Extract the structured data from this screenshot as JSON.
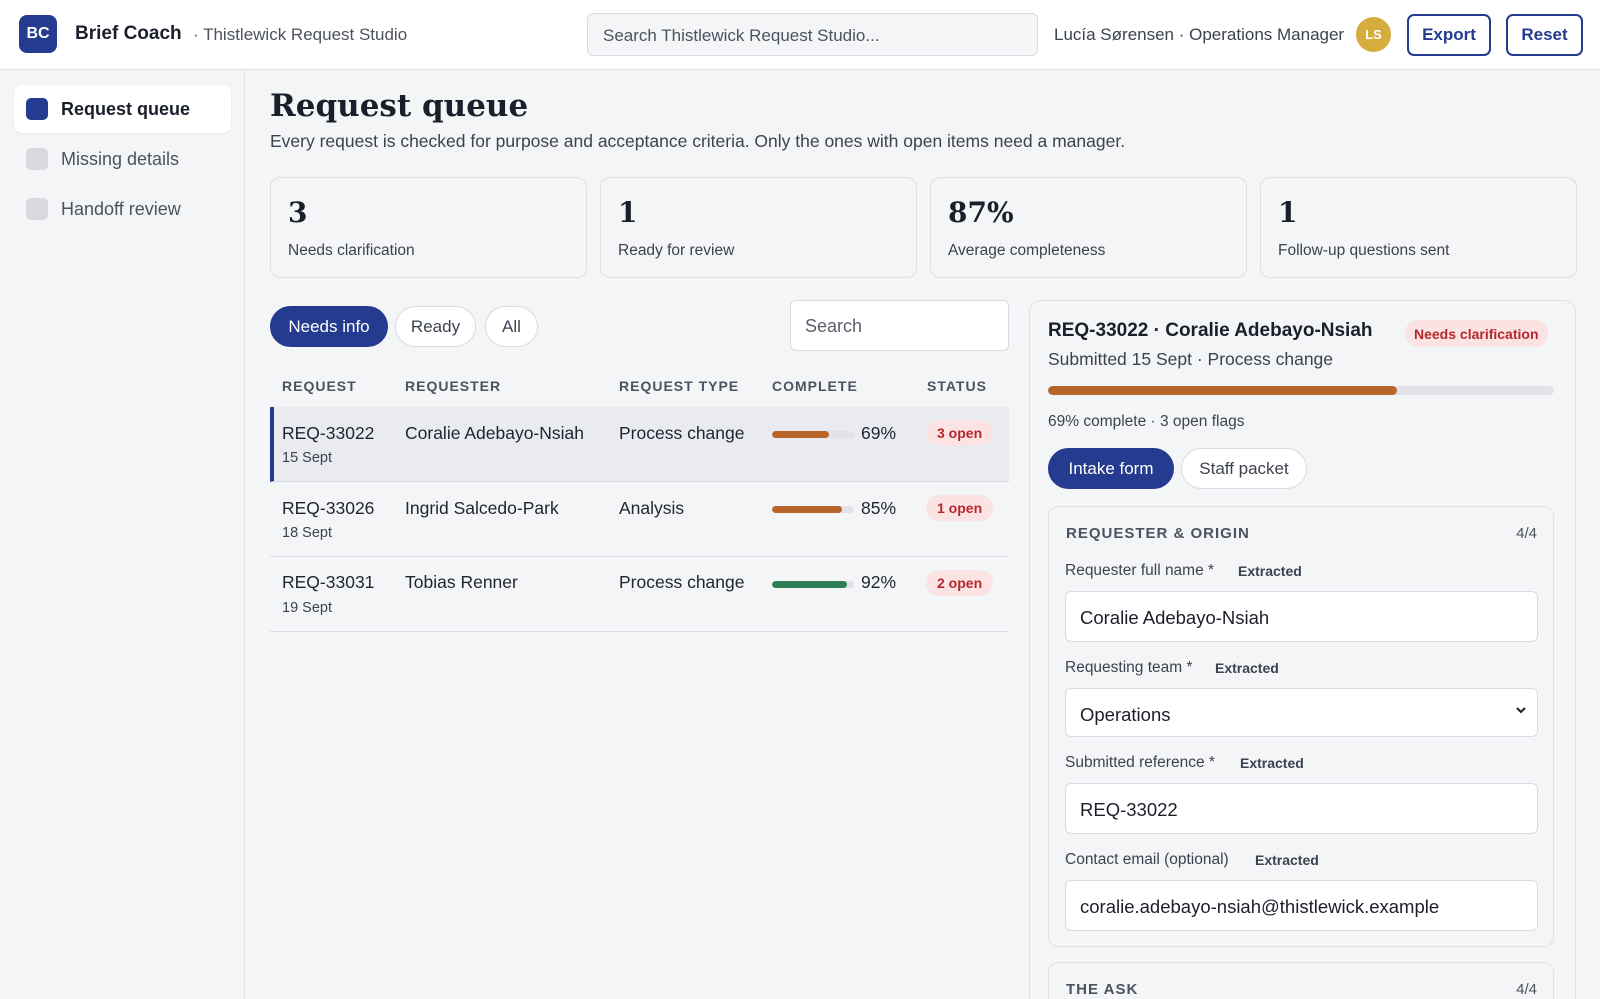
{
  "app": {
    "logo": "BC",
    "name": "Brief Coach",
    "workspace": "· Thistlewick Request Studio"
  },
  "header": {
    "search_placeholder": "Search Thistlewick Request Studio...",
    "user": "Lucía Sørensen · Operations Manager",
    "avatar": "LS",
    "export_label": "Export",
    "reset_label": "Reset"
  },
  "sidebar": {
    "items": [
      {
        "label": "Request queue",
        "active": true
      },
      {
        "label": "Missing details",
        "active": false
      },
      {
        "label": "Handoff review",
        "active": false
      }
    ]
  },
  "main": {
    "title": "Request queue",
    "description": "Every request is checked for purpose and acceptance criteria. Only the ones with open items need a manager.",
    "stats": [
      {
        "value": "3",
        "caption": "Needs clarification"
      },
      {
        "value": "1",
        "caption": "Ready for review"
      },
      {
        "value": "87%",
        "caption": "Average completeness"
      },
      {
        "value": "1",
        "caption": "Follow-up questions sent"
      }
    ],
    "filters": [
      {
        "label": "Needs info",
        "active": true
      },
      {
        "label": "Ready",
        "active": false
      },
      {
        "label": "All",
        "active": false
      }
    ],
    "search_placeholder": "Search",
    "columns": [
      "REQUEST",
      "REQUESTER",
      "REQUEST TYPE",
      "COMPLETE",
      "STATUS"
    ],
    "rows": [
      {
        "id": "REQ-33022",
        "date": "15 Sept",
        "requester": "Coralie Adebayo-Nsiah",
        "type": "Process change",
        "complete": 69,
        "complete_label": "69%",
        "status": "3 open",
        "bar_color": "#b8652a",
        "selected": true
      },
      {
        "id": "REQ-33026",
        "date": "18 Sept",
        "requester": "Ingrid Salcedo-Park",
        "type": "Analysis",
        "complete": 85,
        "complete_label": "85%",
        "status": "1 open",
        "bar_color": "#b8652a",
        "selected": false
      },
      {
        "id": "REQ-33031",
        "date": "19 Sept",
        "requester": "Tobias Renner",
        "type": "Process change",
        "complete": 92,
        "complete_label": "92%",
        "status": "2 open",
        "bar_color": "#2e7d55",
        "selected": false
      }
    ]
  },
  "detail": {
    "title": "REQ-33022 · Coralie Adebayo-Nsiah",
    "status": "Needs clarification",
    "subtitle": "Submitted 15 Sept · Process change",
    "progress": 69,
    "meta": "69% complete · 3 open flags",
    "tabs": [
      {
        "label": "Intake form",
        "active": true
      },
      {
        "label": "Staff packet",
        "active": false
      }
    ],
    "sections": [
      {
        "title": "REQUESTER & ORIGIN",
        "count": "4/4",
        "fields": [
          {
            "label": "Requester full name *",
            "tag": "Extracted",
            "value": "Coralie Adebayo-Nsiah",
            "kind": "text"
          },
          {
            "label": "Requesting team *",
            "tag": "Extracted",
            "value": "Operations",
            "kind": "select"
          },
          {
            "label": "Submitted reference *",
            "tag": "Extracted",
            "value": "REQ-33022",
            "kind": "text"
          },
          {
            "label": "Contact email (optional)",
            "tag": "Extracted",
            "value": "coralie.adebayo-nsiah@thistlewick.example",
            "kind": "text"
          }
        ]
      },
      {
        "title": "THE ASK",
        "count": "4/4"
      }
    ]
  },
  "colors": {
    "accent": "#243b8f",
    "warn_bar": "#b8652a",
    "ok_bar": "#2e7d55",
    "badge_bg": "#fbe3e3",
    "badge_text": "#b5282d",
    "avatar": "#d5ad3d"
  }
}
